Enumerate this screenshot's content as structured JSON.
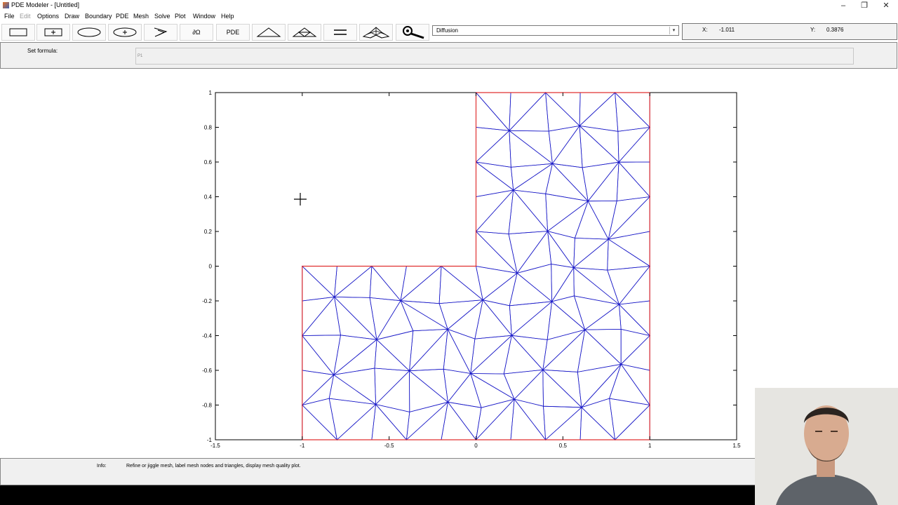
{
  "window": {
    "title": "PDE Modeler - [Untitled]"
  },
  "menu": [
    "File",
    "Edit",
    "Options",
    "Draw",
    "Boundary",
    "PDE",
    "Mesh",
    "Solve",
    "Plot",
    "Window",
    "Help"
  ],
  "menu_disabled": [
    "Edit"
  ],
  "toolbar": {
    "buttons": [
      {
        "name": "rectangle-icon"
      },
      {
        "name": "centered-rectangle-icon"
      },
      {
        "name": "ellipse-icon"
      },
      {
        "name": "centered-ellipse-icon"
      },
      {
        "name": "polygon-icon"
      },
      {
        "name": "boundary-mode-button",
        "label": "∂Ω"
      },
      {
        "name": "pde-mode-button",
        "label": "PDE"
      },
      {
        "name": "init-mesh-icon"
      },
      {
        "name": "refine-mesh-icon"
      },
      {
        "name": "solve-icon"
      },
      {
        "name": "plot-surface-icon"
      },
      {
        "name": "zoom-icon"
      }
    ],
    "application_mode": "Diffusion"
  },
  "coords": {
    "x_label": "X:",
    "x_value": "-1.011",
    "y_label": "Y:",
    "y_value": "0.3876"
  },
  "formula": {
    "label": "Set formula:",
    "value": "P1"
  },
  "info": {
    "label": "Info:",
    "text": "Refine or jiggle mesh, label mesh nodes and triangles, display mesh quality plot."
  },
  "plot": {
    "xlim": [
      -1.5,
      1.5
    ],
    "ylim": [
      -1,
      1
    ],
    "xticks": [
      "-1.5",
      "-1",
      "-0.5",
      "0",
      "0.5",
      "1",
      "1.5"
    ],
    "yticks": [
      "1",
      "0.8",
      "0.6",
      "0.4",
      "0.2",
      "0",
      "-0.2",
      "-0.4",
      "-0.6",
      "-0.8",
      "-1"
    ],
    "boundary_color": "#e03030",
    "mesh_color": "#1c1cc8",
    "geometry": "L-shaped region: [-1,1]x[-1,0] union [0,1]x[0,1], triangulated"
  }
}
